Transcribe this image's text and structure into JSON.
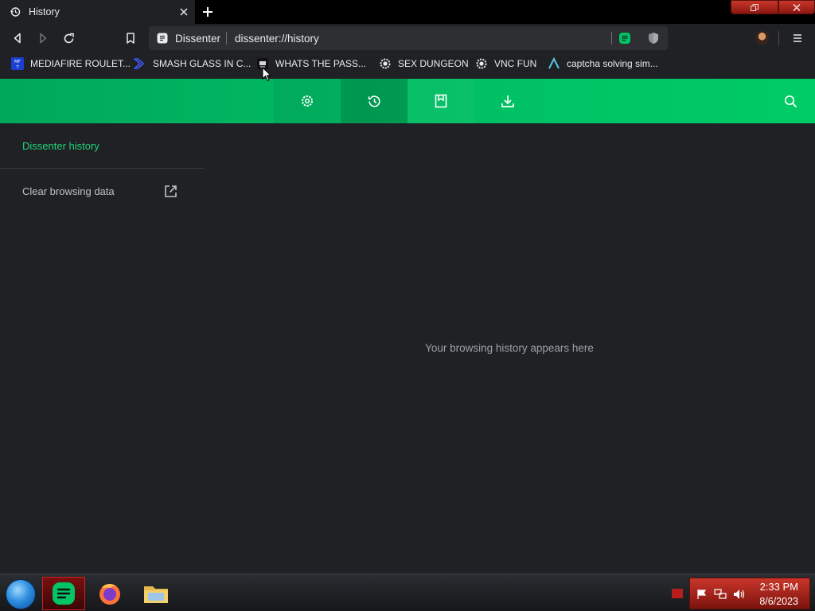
{
  "tab": {
    "title": "History"
  },
  "omnibox": {
    "site_name": "Dissenter",
    "url": "dissenter://history"
  },
  "bookmarks": [
    {
      "label": "MEDIAFIRE ROULET...",
      "icon": "mediafire-icon"
    },
    {
      "label": "SMASH GLASS IN C...",
      "icon": "chevron-bookmark-icon"
    },
    {
      "label": "WHATS THE PASS...",
      "icon": "tv-icon"
    },
    {
      "label": "SEX DUNGEON",
      "icon": "gear-site-icon"
    },
    {
      "label": "VNC FUN",
      "icon": "gear-site-icon"
    },
    {
      "label": "captcha solving sim...",
      "icon": "arc-icon"
    }
  ],
  "sidebar": {
    "title": "Dissenter history",
    "clear_label": "Clear browsing data"
  },
  "main": {
    "empty_message": "Your browsing history appears here"
  },
  "taskbar": {
    "time": "2:33 PM",
    "date": "8/6/2023"
  },
  "colors": {
    "accent": "#1ed37a",
    "header_green": "#00c465",
    "background": "#202124"
  }
}
